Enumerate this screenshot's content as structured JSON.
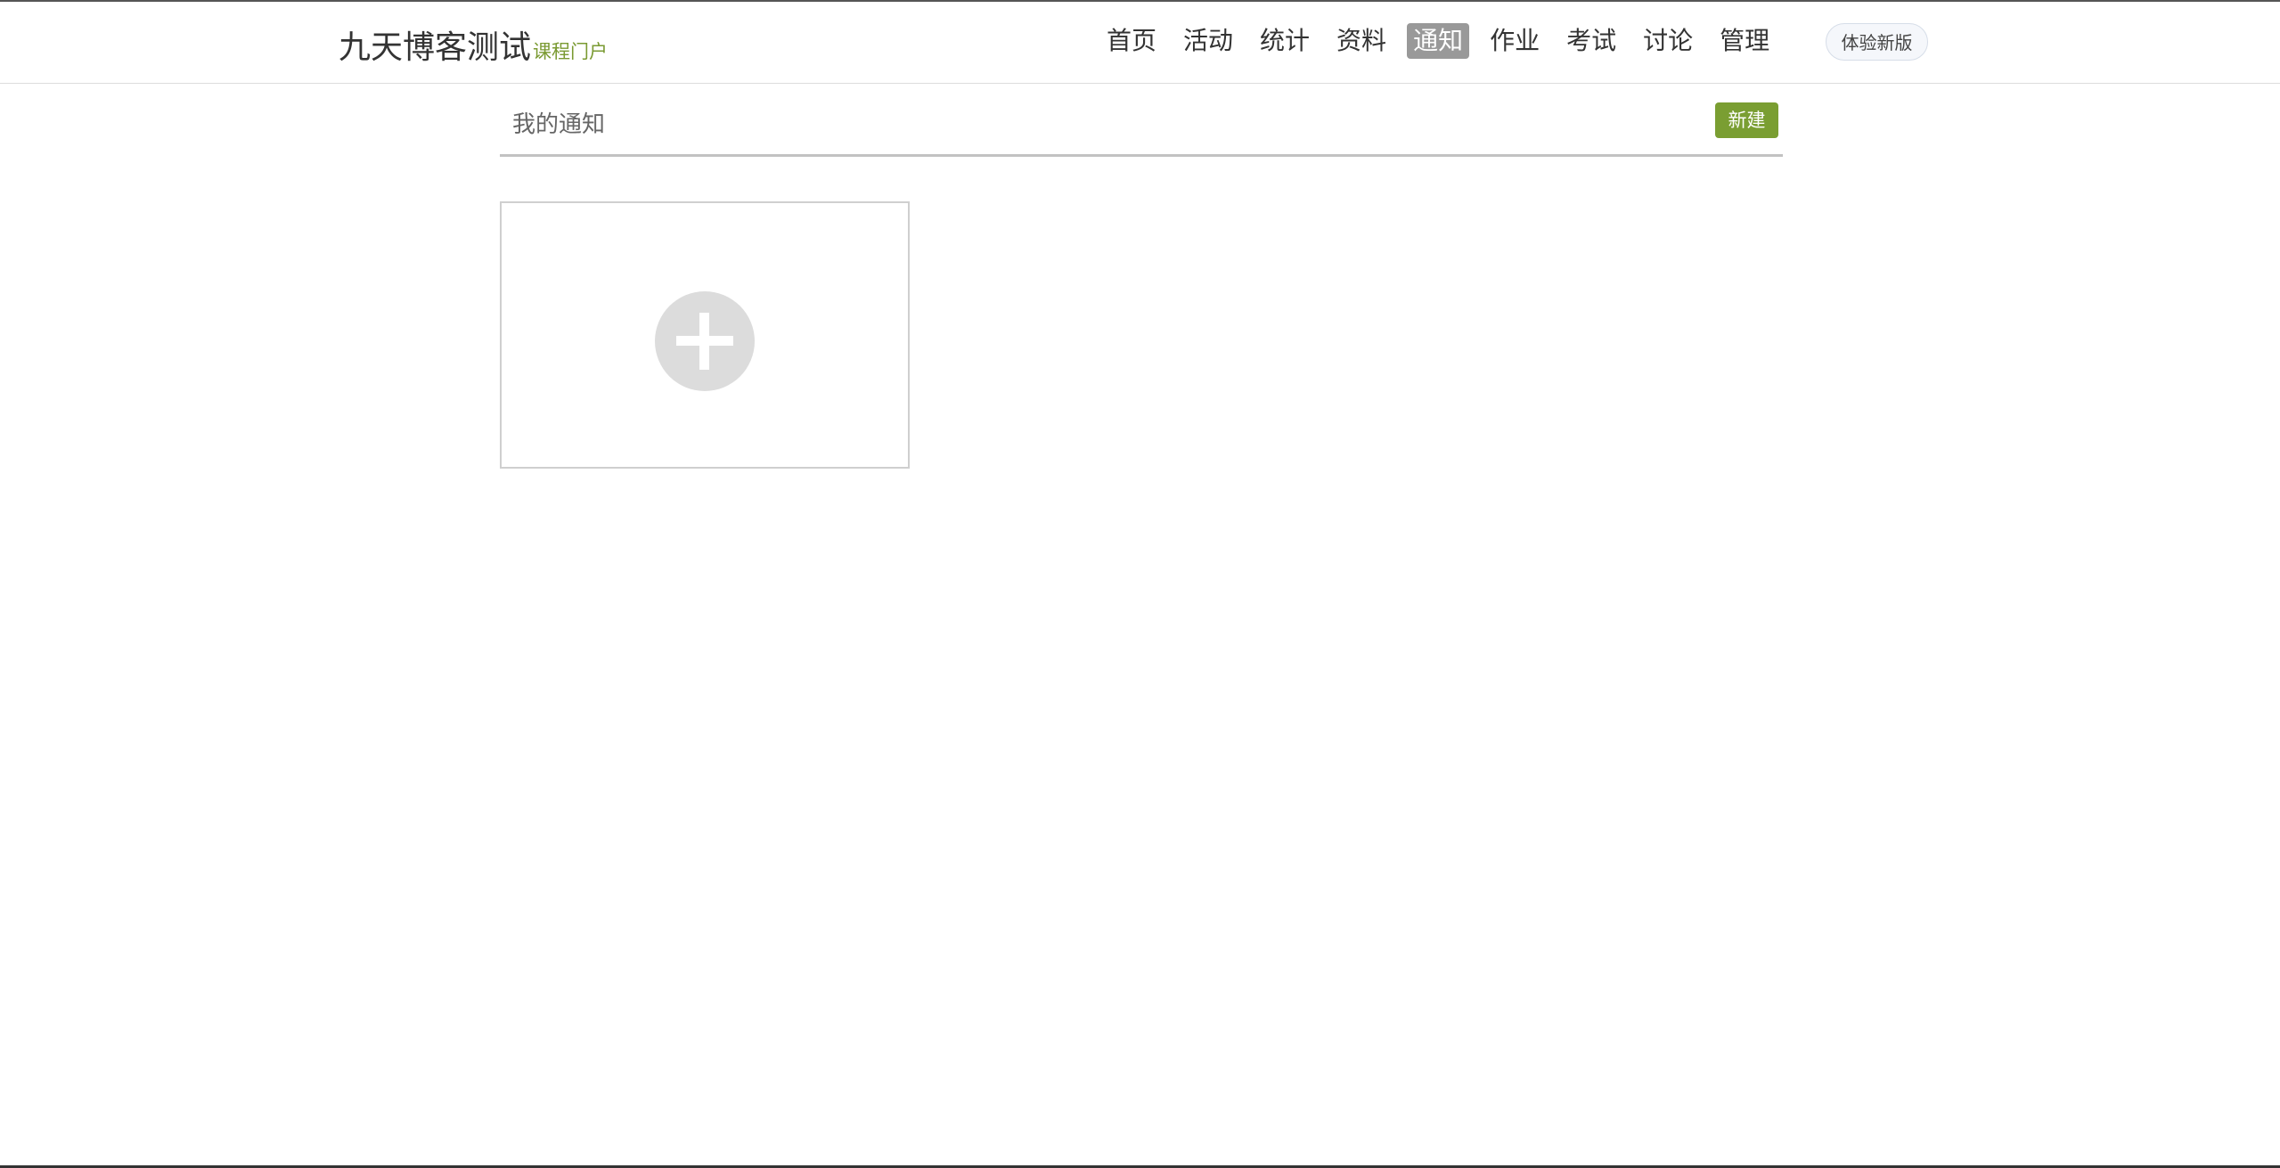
{
  "header": {
    "brand_title": "九天博客测试",
    "brand_subtitle": "课程门户",
    "nav": [
      {
        "label": "首页",
        "active": false
      },
      {
        "label": "活动",
        "active": false
      },
      {
        "label": "统计",
        "active": false
      },
      {
        "label": "资料",
        "active": false
      },
      {
        "label": "通知",
        "active": true
      },
      {
        "label": "作业",
        "active": false
      },
      {
        "label": "考试",
        "active": false
      },
      {
        "label": "讨论",
        "active": false
      },
      {
        "label": "管理",
        "active": false
      }
    ],
    "try_new_label": "体验新版"
  },
  "main": {
    "section_title": "我的通知",
    "new_button_label": "新建",
    "add_card_icon": "plus-circle-icon"
  },
  "colors": {
    "accent_green": "#7a9e32",
    "nav_active_bg": "#999999",
    "card_border": "#cfcfcf"
  }
}
